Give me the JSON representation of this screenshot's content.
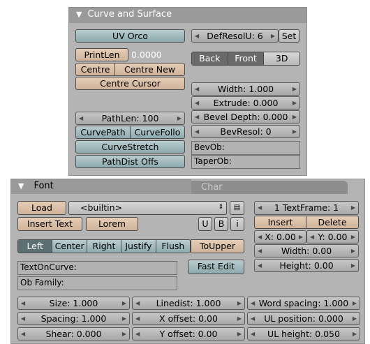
{
  "curve_panel": {
    "title": "Curve and Surface",
    "uv_orco": "UV Orco",
    "print_len": "PrintLen",
    "print_len_value": "0.0000",
    "centre": "Centre",
    "centre_new": "Centre New",
    "centre_cursor": "Centre Cursor",
    "def_resol_u": "DefResolU: 6",
    "set": "Set",
    "back": "Back",
    "front": "Front",
    "three_d": "3D",
    "width": "Width: 1.000",
    "extrude": "Extrude: 0.000",
    "bevel_depth": "Bevel Depth: 0.000",
    "bev_resol": "BevResol: 0",
    "bev_ob": "BevOb:",
    "taper_ob": "TaperOb:",
    "path_len": "PathLen: 100",
    "curve_path": "CurvePath",
    "curve_follow": "CurveFollo",
    "curve_stretch": "CurveStretch",
    "path_dist_offs": "PathDist Offs"
  },
  "font_panel": {
    "tab_font": "Font",
    "tab_char": "Char",
    "load": "Load",
    "font_name": "<builtin>",
    "insert_text": "Insert Text",
    "lorem": "Lorem",
    "u": "U",
    "b": "B",
    "i": "i",
    "align": [
      "Left",
      "Center",
      "Right",
      "Justify",
      "Flush"
    ],
    "to_upper": "ToUpper",
    "text_on_curve": "TextOnCurve:",
    "ob_family": "Ob Family:",
    "fast_edit": "Fast Edit",
    "text_frame": "1 TextFrame: 1",
    "insert": "Insert",
    "delete": "Delete",
    "x": "X: 0.00",
    "y": "Y: 0.00",
    "width": "Width: 0.00",
    "height": "Height: 0.00",
    "size": "Size: 1.000",
    "spacing": "Spacing: 1.000",
    "shear": "Shear: 0.000",
    "linedist": "Linedist: 1.000",
    "x_offset": "X offset: 0.00",
    "y_offset": "Y offset: 0.00",
    "word_spacing": "Word spacing: 1.000",
    "ul_position": "UL position: 0.000",
    "ul_height": "UL height: 0.050"
  }
}
